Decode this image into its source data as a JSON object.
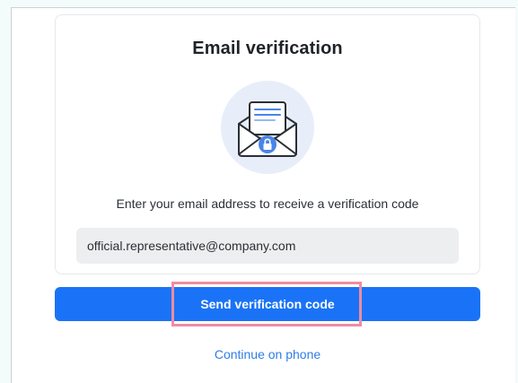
{
  "card": {
    "title": "Email verification",
    "illustration_icon": "envelope-lock-icon",
    "instruction": "Enter your email address to receive a verification code",
    "email_value": "official.representative@company.com"
  },
  "actions": {
    "send_label": "Send verification code",
    "phone_link_label": "Continue on phone"
  },
  "colors": {
    "primary": "#1a73f6",
    "link": "#2f7de6",
    "highlight_border": "#f08ca1",
    "input_bg": "#eceef0",
    "illustration_bg": "#e8eef9",
    "lock_badge": "#4a84e8"
  }
}
